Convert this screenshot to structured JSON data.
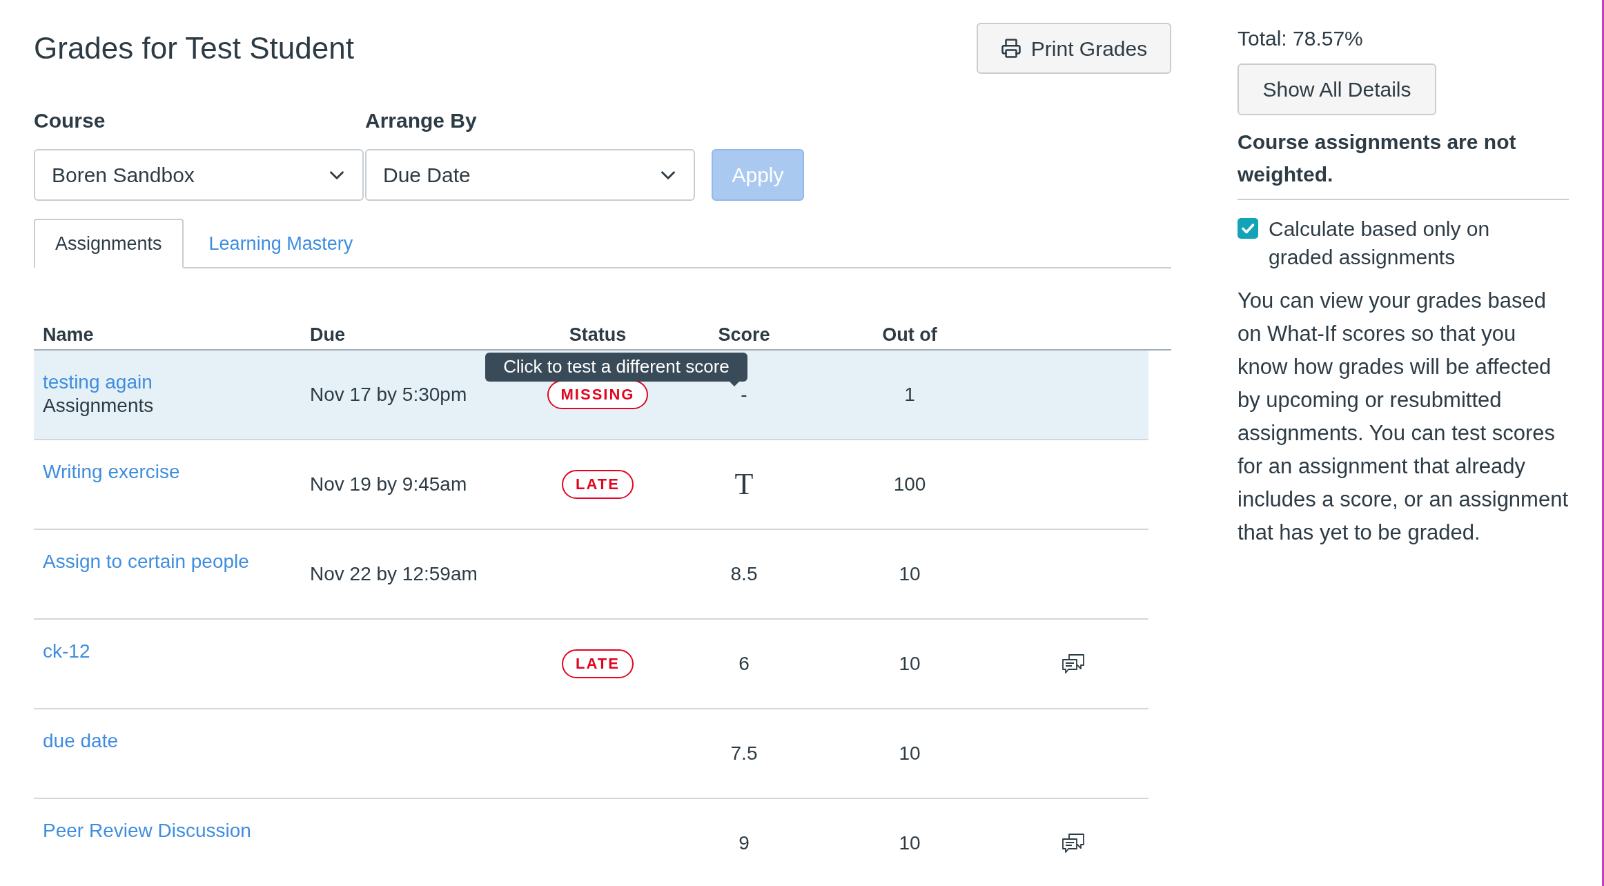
{
  "page": {
    "title": "Grades for Test Student",
    "print_button": "Print Grades"
  },
  "filters": [
    {
      "label": "Course",
      "value": "Boren Sandbox"
    },
    {
      "label": "Arrange By",
      "value": "Due Date"
    }
  ],
  "apply_button": {
    "label": "Apply",
    "disabled": true
  },
  "tabs": [
    {
      "label": "Assignments",
      "selected": true
    },
    {
      "label": "Learning Mastery",
      "selected": false
    }
  ],
  "table": {
    "columns": [
      "Name",
      "Due",
      "Status",
      "Score",
      "Out of"
    ],
    "rows": [
      {
        "name": "testing again",
        "group": "Assignments",
        "due": "Nov 17 by 5:30pm",
        "status": "MISSING",
        "score": {
          "kind": "plain",
          "text": "-"
        },
        "score_tooltip": "Click to test a different score",
        "out_of": "1",
        "comments": false,
        "highlighted": true
      },
      {
        "name": "Writing exercise",
        "due": "Nov 19 by 9:45am",
        "status": "LATE",
        "score": {
          "kind": "glyph",
          "text": "T"
        },
        "out_of": "100",
        "comments": false,
        "highlighted": false
      },
      {
        "name": "Assign to certain people",
        "due": "Nov 22 by 12:59am",
        "score": {
          "kind": "plain",
          "text": "8.5"
        },
        "out_of": "10",
        "comments": false,
        "highlighted": false
      },
      {
        "name": "ck-12",
        "status": "LATE",
        "score": {
          "kind": "plain",
          "text": "6"
        },
        "out_of": "10",
        "comments": true,
        "highlighted": false
      },
      {
        "name": "due date",
        "score": {
          "kind": "plain",
          "text": "7.5"
        },
        "out_of": "10",
        "comments": false,
        "highlighted": false
      },
      {
        "name": "Peer Review Discussion",
        "score": {
          "kind": "plain",
          "text": "9"
        },
        "out_of": "10",
        "comments": true,
        "highlighted": false
      }
    ]
  },
  "sidebar": {
    "total": "Total: 78.57%",
    "details_button": "Show All Details",
    "note": "Course assignments are not weighted.",
    "checkbox": {
      "label": "Calculate based only on graded assignments",
      "checked": true
    },
    "help_text": "You can view your grades based on What-If scores so that you know how grades will be affected by upcoming or resubmitted assignments. You can test scores for an assignment that already includes a score, or an assignment that has yet to be graded."
  }
}
